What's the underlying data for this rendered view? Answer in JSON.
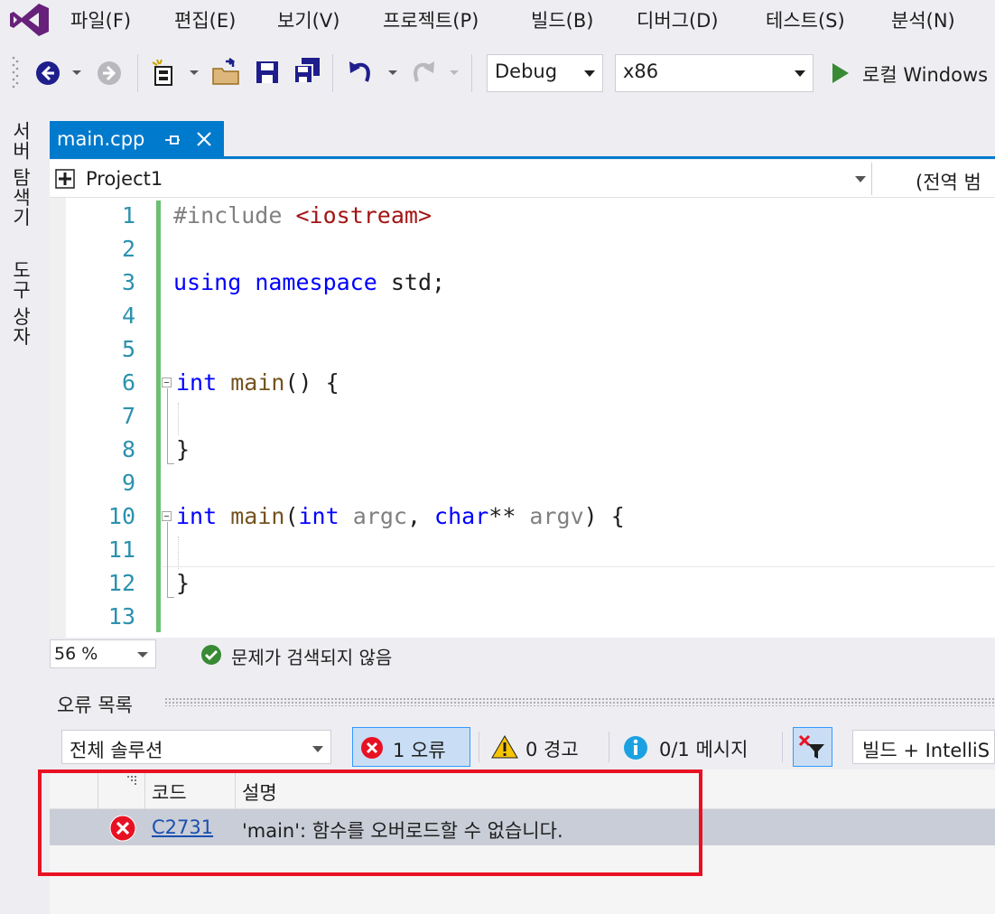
{
  "menu": {
    "items": [
      "파일(F)",
      "편집(E)",
      "보기(V)",
      "프로젝트(P)",
      "빌드(B)",
      "디버그(D)",
      "테스트(S)",
      "분석(N)"
    ]
  },
  "toolbar": {
    "configuration": "Debug",
    "platform": "x86",
    "run_label": "로컬 Windows"
  },
  "side_tabs": {
    "server_explorer": "서버 탐색기",
    "toolbox": "도구 상자"
  },
  "document_tab": {
    "filename": "main.cpp"
  },
  "nav_bar": {
    "project": "Project1",
    "scope": "(전역 범"
  },
  "editor": {
    "line_numbers": [
      "1",
      "2",
      "3",
      "4",
      "5",
      "6",
      "7",
      "8",
      "9",
      "10",
      "11",
      "12",
      "13"
    ]
  },
  "status": {
    "zoom": "56 %",
    "issues": "문제가 검색되지 않음"
  },
  "error_list": {
    "title": "오류 목록",
    "scope": "전체 솔루션",
    "errors_label": "1 오류",
    "warnings_label": "0 경고",
    "messages_label": "0/1 메시지",
    "source_filter": "빌드 + IntelliS",
    "columns": {
      "code": "코드",
      "description": "설명"
    },
    "rows": [
      {
        "code": "C2731",
        "description": "'main': 함수를 오버로드할 수 없습니다."
      }
    ]
  },
  "colors": {
    "accent": "#007acc",
    "highlight_box": "#e81123",
    "error_icon": "#e81123"
  }
}
